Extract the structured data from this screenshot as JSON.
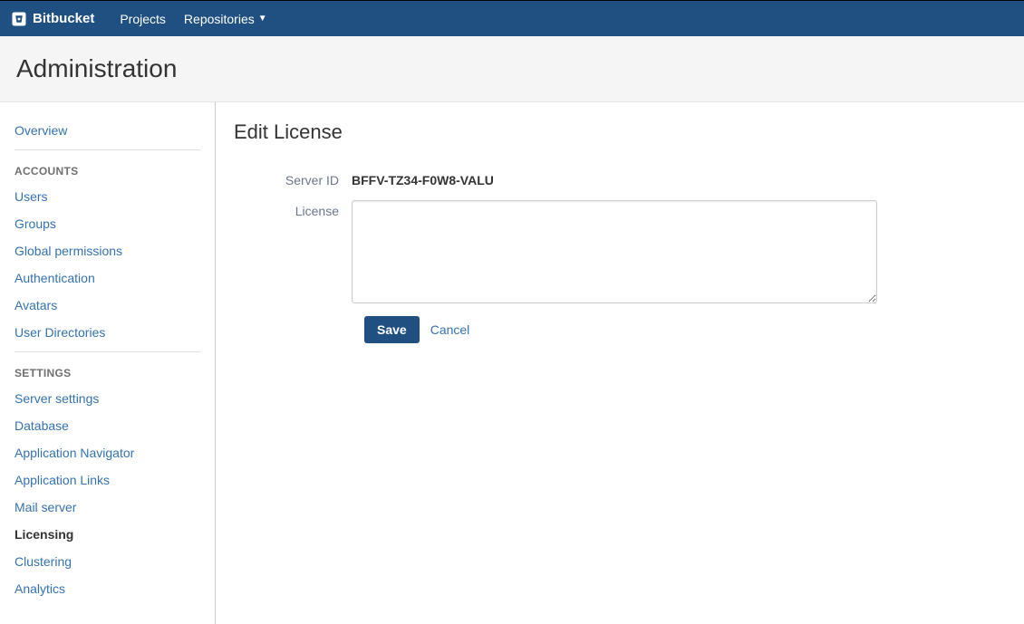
{
  "topbar": {
    "brand": "Bitbucket",
    "nav": {
      "projects": "Projects",
      "repositories": "Repositories"
    }
  },
  "header": {
    "title": "Administration"
  },
  "sidebar": {
    "overview": "Overview",
    "accounts_header": "ACCOUNTS",
    "accounts": {
      "users": "Users",
      "groups": "Groups",
      "global_permissions": "Global permissions",
      "authentication": "Authentication",
      "avatars": "Avatars",
      "user_directories": "User Directories"
    },
    "settings_header": "SETTINGS",
    "settings": {
      "server_settings": "Server settings",
      "database": "Database",
      "application_navigator": "Application Navigator",
      "application_links": "Application Links",
      "mail_server": "Mail server",
      "licensing": "Licensing",
      "clustering": "Clustering",
      "analytics": "Analytics"
    }
  },
  "content": {
    "title": "Edit License",
    "server_id_label": "Server ID",
    "server_id_value": "BFFV-TZ34-F0W8-VALU",
    "license_label": "License",
    "license_value": "",
    "save_label": "Save",
    "cancel_label": "Cancel"
  }
}
